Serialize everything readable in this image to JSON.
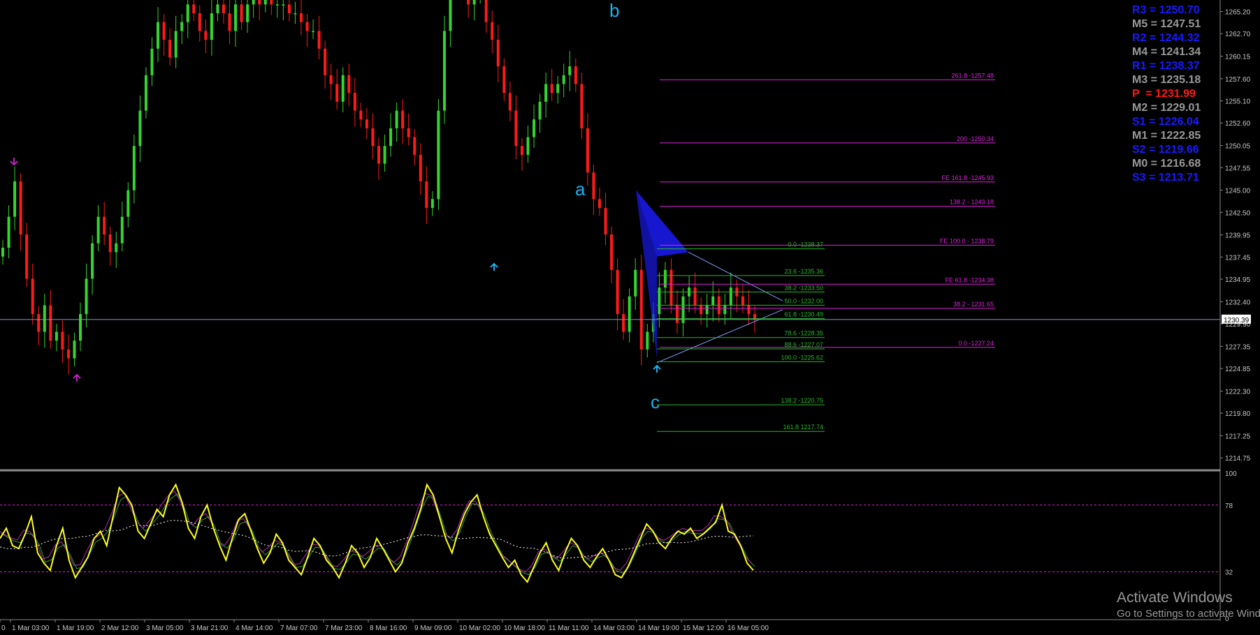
{
  "colors": {
    "background": "#000000",
    "bull_candle": "#33d62e",
    "bear_candle": "#ff1a1a",
    "fib_magenta": "#e020e0",
    "fib_green": "#2bb82b",
    "triangle_fill": "#1a1ae6",
    "wave_label": "#1ab3f2",
    "osc_main": "#ffff1a",
    "axis_text": "#c8c8c8",
    "current_price_line": "#7f9fbf"
  },
  "chart_data": {
    "type": "candlestick",
    "price_axis": {
      "ylim": [
        1213.5,
        1266.5
      ],
      "ticks": [
        "1265.20",
        "1262.70",
        "1260.15",
        "1257.60",
        "1255.10",
        "1252.60",
        "1250.05",
        "1247.55",
        "1245.00",
        "1242.50",
        "1239.95",
        "1237.45",
        "1234.95",
        "1232.40",
        "1229.90",
        "1227.35",
        "1224.85",
        "1222.30",
        "1219.80",
        "1217.25",
        "1214.75"
      ]
    },
    "current_price": "1230.39",
    "time_axis": {
      "labels": [
        "0",
        "1 Mar 03:00",
        "1 Mar 19:00",
        "2 Mar 12:00",
        "3 Mar 05:00",
        "3 Mar 21:00",
        "4 Mar 14:00",
        "7 Mar 07:00",
        "7 Mar 23:00",
        "8 Mar 16:00",
        "9 Mar 09:00",
        "10 Mar 02:00",
        "10 Mar 18:00",
        "11 Mar 11:00",
        "14 Mar 03:00",
        "14 Mar 19:00",
        "15 Mar 12:00",
        "16 Mar 05:00"
      ],
      "bar_count": 170
    },
    "closes": [
      1238.5,
      1242,
      1246,
      1240,
      1235,
      1231,
      1229,
      1232,
      1228,
      1229,
      1227,
      1226,
      1228,
      1231,
      1235,
      1239,
      1242,
      1240,
      1238,
      1239,
      1242,
      1245,
      1250,
      1254,
      1258,
      1261,
      1264,
      1262,
      1260,
      1263,
      1264,
      1266,
      1265,
      1263,
      1262,
      1265,
      1266,
      1265,
      1263,
      1266,
      1264,
      1266,
      1267,
      1266,
      1267,
      1266,
      1266,
      1266,
      1265,
      1265,
      1264,
      1263,
      1263,
      1261,
      1258,
      1257,
      1255,
      1258,
      1256,
      1254,
      1253,
      1252,
      1250,
      1248,
      1250,
      1252,
      1254,
      1252,
      1251,
      1249,
      1246,
      1243,
      1244,
      1254,
      1263,
      1268,
      1269,
      1268,
      1266,
      1267,
      1267,
      1264,
      1262,
      1259,
      1256,
      1254,
      1250,
      1249,
      1251,
      1253,
      1255,
      1257,
      1256,
      1257,
      1258,
      1259,
      1257,
      1252,
      1247,
      1244,
      1243,
      1240,
      1236,
      1231,
      1229,
      1233,
      1236,
      1227,
      1229,
      1231,
      1234,
      1236,
      1232,
      1230,
      1233,
      1234,
      1232,
      1231,
      1232,
      1233,
      1231,
      1232,
      1234,
      1233,
      1232,
      1231,
      1230.4
    ],
    "pivot_levels": [
      {
        "name": "R3",
        "text": "R3 = 1250.70",
        "color": "#1a1aff"
      },
      {
        "name": "M5",
        "text": "M5 = 1247.51",
        "color": "#999999"
      },
      {
        "name": "R2",
        "text": "R2 = 1244.32",
        "color": "#1a1aff"
      },
      {
        "name": "M4",
        "text": "M4 = 1241.34",
        "color": "#999999"
      },
      {
        "name": "R1",
        "text": "R1 = 1238.37",
        "color": "#1a1aff"
      },
      {
        "name": "M3",
        "text": "M3 = 1235.18",
        "color": "#999999"
      },
      {
        "name": "P",
        "text": "P  = 1231.99",
        "color": "#ff1a1a"
      },
      {
        "name": "M2",
        "text": "M2 = 1229.01",
        "color": "#999999"
      },
      {
        "name": "S1",
        "text": "S1 = 1226.04",
        "color": "#1a1aff"
      },
      {
        "name": "M1",
        "text": "M1 = 1222.85",
        "color": "#999999"
      },
      {
        "name": "S2",
        "text": "S2 = 1219.66",
        "color": "#1a1aff"
      },
      {
        "name": "M0",
        "text": "M0 = 1216.68",
        "color": "#999999"
      },
      {
        "name": "S3",
        "text": "S3 = 1213.71",
        "color": "#1a1aff"
      }
    ],
    "fib_magenta": [
      {
        "price": 1257.48,
        "label": "261.8 -1257.48"
      },
      {
        "price": 1250.34,
        "label": "200 -1250.34"
      },
      {
        "price": 1245.93,
        "label": "FE 161.8 -1245.93"
      },
      {
        "price": 1243.18,
        "label": "138.2 - 1243.18"
      },
      {
        "price": 1238.79,
        "label": "FE 100.0 - 1238.79"
      },
      {
        "price": 1234.38,
        "label": "FE 61.8 -1234.38"
      },
      {
        "price": 1231.65,
        "label": "38.2 - 1231.65"
      },
      {
        "price": 1227.24,
        "label": "0.0 -1227.24"
      }
    ],
    "fib_green": [
      {
        "price": 1238.37,
        "label": "0.0 -1238.37"
      },
      {
        "price": 1235.36,
        "label": "23.6 -1235.36"
      },
      {
        "price": 1233.5,
        "label": "38.2 -1233.50"
      },
      {
        "price": 1232.0,
        "label": "50.0 -1232.00"
      },
      {
        "price": 1230.49,
        "label": "61.8 -1230.49"
      },
      {
        "price": 1228.35,
        "label": "78.6 -1228.35"
      },
      {
        "price": 1227.07,
        "label": "88.6 -1227.07"
      },
      {
        "price": 1225.62,
        "label": "100.0 -1225.62"
      },
      {
        "price": 1220.75,
        "label": "138.2 -1220.75"
      },
      {
        "price": 1217.74,
        "label": "161.8 1217.74"
      }
    ],
    "wave_labels": [
      "a",
      "b",
      "c"
    ],
    "oscillator": {
      "ylim": [
        0,
        100
      ],
      "tick_labels": [
        "100",
        "78",
        "32",
        "0"
      ],
      "levels": [
        78,
        32
      ],
      "values": [
        55,
        62,
        50,
        48,
        58,
        70,
        45,
        38,
        33,
        50,
        62,
        40,
        28,
        35,
        42,
        55,
        60,
        50,
        70,
        90,
        85,
        78,
        60,
        55,
        65,
        75,
        70,
        85,
        92,
        80,
        62,
        55,
        70,
        78,
        62,
        50,
        40,
        55,
        68,
        72,
        60,
        48,
        38,
        45,
        58,
        52,
        40,
        35,
        30,
        42,
        55,
        50,
        40,
        35,
        28,
        38,
        50,
        45,
        35,
        42,
        55,
        48,
        40,
        32,
        38,
        52,
        62,
        75,
        92,
        85,
        70,
        55,
        45,
        60,
        72,
        80,
        85,
        70,
        58,
        50,
        42,
        35,
        40,
        30,
        25,
        35,
        45,
        52,
        40,
        33,
        45,
        55,
        50,
        40,
        35,
        42,
        48,
        40,
        30,
        28,
        35,
        45,
        55,
        65,
        60,
        52,
        48,
        55,
        60,
        58,
        62,
        55,
        58,
        62,
        66,
        78,
        60,
        58,
        50,
        38,
        33
      ]
    }
  },
  "watermark": {
    "title": "Activate Windows",
    "subtitle": "Go to Settings to activate Windows."
  }
}
